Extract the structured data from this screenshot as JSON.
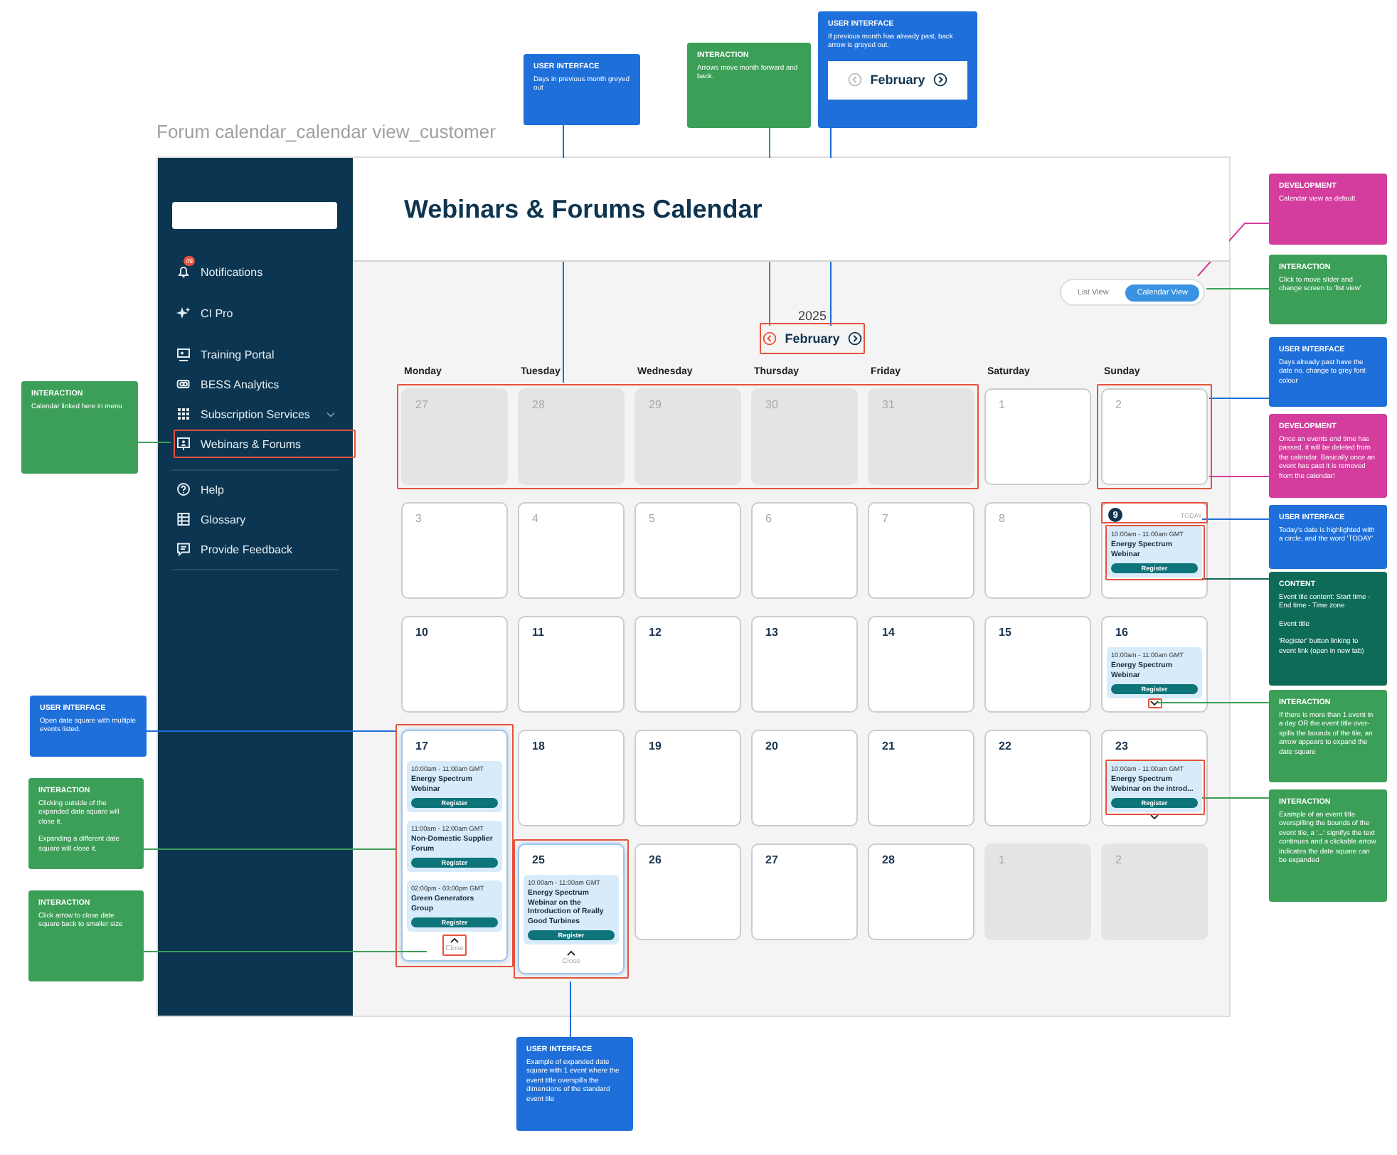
{
  "page_title": "Forum calendar_calendar view_customer",
  "sidebar": {
    "groups": [
      [
        {
          "label": "Notifications",
          "badge": "49"
        },
        {
          "label": "CI Pro"
        }
      ],
      [
        {
          "label": "Training Portal"
        },
        {
          "label": "BESS Analytics"
        },
        {
          "label": "Subscription Services",
          "expanded": false
        },
        {
          "label": "Webinars & Forums"
        }
      ],
      [
        {
          "label": "Help"
        },
        {
          "label": "Glossary"
        },
        {
          "label": "Provide Feedback"
        }
      ]
    ]
  },
  "header": {
    "title": "Webinars & Forums Calendar"
  },
  "view_toggle": {
    "options": [
      {
        "label": "List View",
        "selected": false
      },
      {
        "label": "Calendar View",
        "selected": true
      }
    ]
  },
  "year": "2025",
  "month_nav": {
    "month": "February",
    "prev_disabled": false
  },
  "weekdays": [
    "Monday",
    "Tuesday",
    "Wednesday",
    "Thursday",
    "Friday",
    "Saturday",
    "Sunday"
  ],
  "calendar": {
    "weeks": [
      {
        "days": [
          {
            "date": "27",
            "kind": "outside"
          },
          {
            "date": "28",
            "kind": "outside"
          },
          {
            "date": "29",
            "kind": "outside"
          },
          {
            "date": "30",
            "kind": "outside"
          },
          {
            "date": "31",
            "kind": "outside"
          },
          {
            "date": "1",
            "kind": "past"
          },
          {
            "date": "2",
            "kind": "past"
          }
        ]
      },
      {
        "days": [
          {
            "date": "3",
            "kind": "past"
          },
          {
            "date": "4",
            "kind": "past"
          },
          {
            "date": "5",
            "kind": "past"
          },
          {
            "date": "6",
            "kind": "past"
          },
          {
            "date": "7",
            "kind": "past"
          },
          {
            "date": "8",
            "kind": "past"
          },
          {
            "date": "9",
            "kind": "today",
            "today_label": "TODAY",
            "expanded": false,
            "expand_arrow": false,
            "events": [
              {
                "time": "10:00am - 11:00am GMT",
                "title": "Energy Spectrum Webinar",
                "button": "Register"
              }
            ]
          }
        ]
      },
      {
        "days": [
          {
            "date": "10",
            "kind": "current"
          },
          {
            "date": "11",
            "kind": "current"
          },
          {
            "date": "12",
            "kind": "current"
          },
          {
            "date": "13",
            "kind": "current"
          },
          {
            "date": "14",
            "kind": "current"
          },
          {
            "date": "15",
            "kind": "current"
          },
          {
            "date": "16",
            "kind": "current",
            "expanded": false,
            "expand_arrow": true,
            "events": [
              {
                "time": "10:00am - 11:00am GMT",
                "title": "Energy Spectrum Webinar",
                "button": "Register"
              }
            ]
          }
        ]
      },
      {
        "days": [
          {
            "date": "17",
            "kind": "current",
            "expanded": true,
            "expand_arrow": false,
            "close_label": "Close",
            "events": [
              {
                "time": "10:00am - 11:00am GMT",
                "title": "Energy Spectrum Webinar",
                "button": "Register"
              },
              {
                "time": "11:00am - 12:00am GMT",
                "title": "Non-Domestic Supplier Forum",
                "button": "Register"
              },
              {
                "time": "02:00pm - 03:00pm GMT",
                "title": "Green Generators Group",
                "button": "Register"
              }
            ]
          },
          {
            "date": "18",
            "kind": "current"
          },
          {
            "date": "19",
            "kind": "current"
          },
          {
            "date": "20",
            "kind": "current"
          },
          {
            "date": "21",
            "kind": "current"
          },
          {
            "date": "22",
            "kind": "current"
          },
          {
            "date": "23",
            "kind": "current",
            "expanded": false,
            "expand_arrow": true,
            "events": [
              {
                "time": "10:00am - 11:00am GMT",
                "title": "Energy Spectrum Webinar on the introd...",
                "button": "Register"
              }
            ]
          }
        ]
      },
      {
        "days": [
          {
            "date": "25",
            "kind": "current",
            "expanded": true,
            "expand_arrow": false,
            "close_label": "Close",
            "events": [
              {
                "time": "10:00am - 11:00am GMT",
                "title": "Energy Spectrum Webinar on the Introduction of Really Good Turbines",
                "button": "Register"
              }
            ]
          },
          {
            "date": "26",
            "kind": "current"
          },
          {
            "date": "27",
            "kind": "current"
          },
          {
            "date": "28",
            "kind": "current"
          },
          {
            "date": "1",
            "kind": "outside"
          },
          {
            "date": "2",
            "kind": "outside"
          }
        ]
      }
    ]
  },
  "notes": [
    {
      "kind": "user_interface",
      "heading": "USER INTERFACE",
      "paragraphs": [
        "Days in previous month greyed out"
      ]
    },
    {
      "kind": "interaction",
      "heading": "INTERACTION",
      "paragraphs": [
        "Arrows move month forward and back."
      ]
    },
    {
      "kind": "user_interface",
      "heading": "USER INTERFACE",
      "paragraphs": [
        "If previous month has already past, back arrow is greyed out."
      ],
      "preview": {
        "month": "February",
        "prev_disabled": true
      }
    },
    {
      "kind": "development",
      "heading": "DEVELOPMENT",
      "paragraphs": [
        "Calendar view as default"
      ]
    },
    {
      "kind": "interaction",
      "heading": "INTERACTION",
      "paragraphs": [
        "Click to move slider and change screen to 'list view'"
      ]
    },
    {
      "kind": "user_interface",
      "heading": "USER INTERFACE",
      "paragraphs": [
        "Days already past have the date no. change to grey font colour"
      ]
    },
    {
      "kind": "development",
      "heading": "DEVELOPMENT",
      "paragraphs": [
        "Once an events end time has passed, it will be deleted from the calendar. Basically once an event has past it is removed from the calendar!"
      ]
    },
    {
      "kind": "user_interface",
      "heading": "USER INTERFACE",
      "paragraphs": [
        "Today's date is highlighted with a circle, and the word 'TODAY'"
      ]
    },
    {
      "kind": "content",
      "heading": "CONTENT",
      "paragraphs": [
        "Event tile content: Start time - End time - Time zone",
        "Event title",
        "'Register' button linking to event link (open in new tab)"
      ]
    },
    {
      "kind": "interaction",
      "heading": "INTERACTION",
      "paragraphs": [
        "If there is more than 1 event in a day OR the event title over-spills the bounds of the tile, an arrow appears to expand the date square"
      ]
    },
    {
      "kind": "interaction",
      "heading": "INTERACTION",
      "paragraphs": [
        "Example of an event title overspilling the bounds of the event tile, a '...' signifys the text continues and a clickable arrow indicates the date square can be expanded"
      ]
    },
    {
      "kind": "interaction",
      "heading": "INTERACTION",
      "paragraphs": [
        "Calendar linked here in menu"
      ]
    },
    {
      "kind": "user_interface",
      "heading": "USER INTERFACE",
      "paragraphs": [
        "Open date square with multiple events listed."
      ]
    },
    {
      "kind": "interaction",
      "heading": "INTERACTION",
      "paragraphs": [
        "Clicking outside of the expanded date square will close it.",
        "Expanding a different date square will close it."
      ]
    },
    {
      "kind": "interaction",
      "heading": "INTERACTION",
      "paragraphs": [
        "Click arrow to close date square back to smaller size"
      ]
    },
    {
      "kind": "user_interface",
      "heading": "USER INTERFACE",
      "paragraphs": [
        "Example of expanded date square with 1 event where the event title overspills the dimensions of the standard event tile"
      ]
    }
  ]
}
